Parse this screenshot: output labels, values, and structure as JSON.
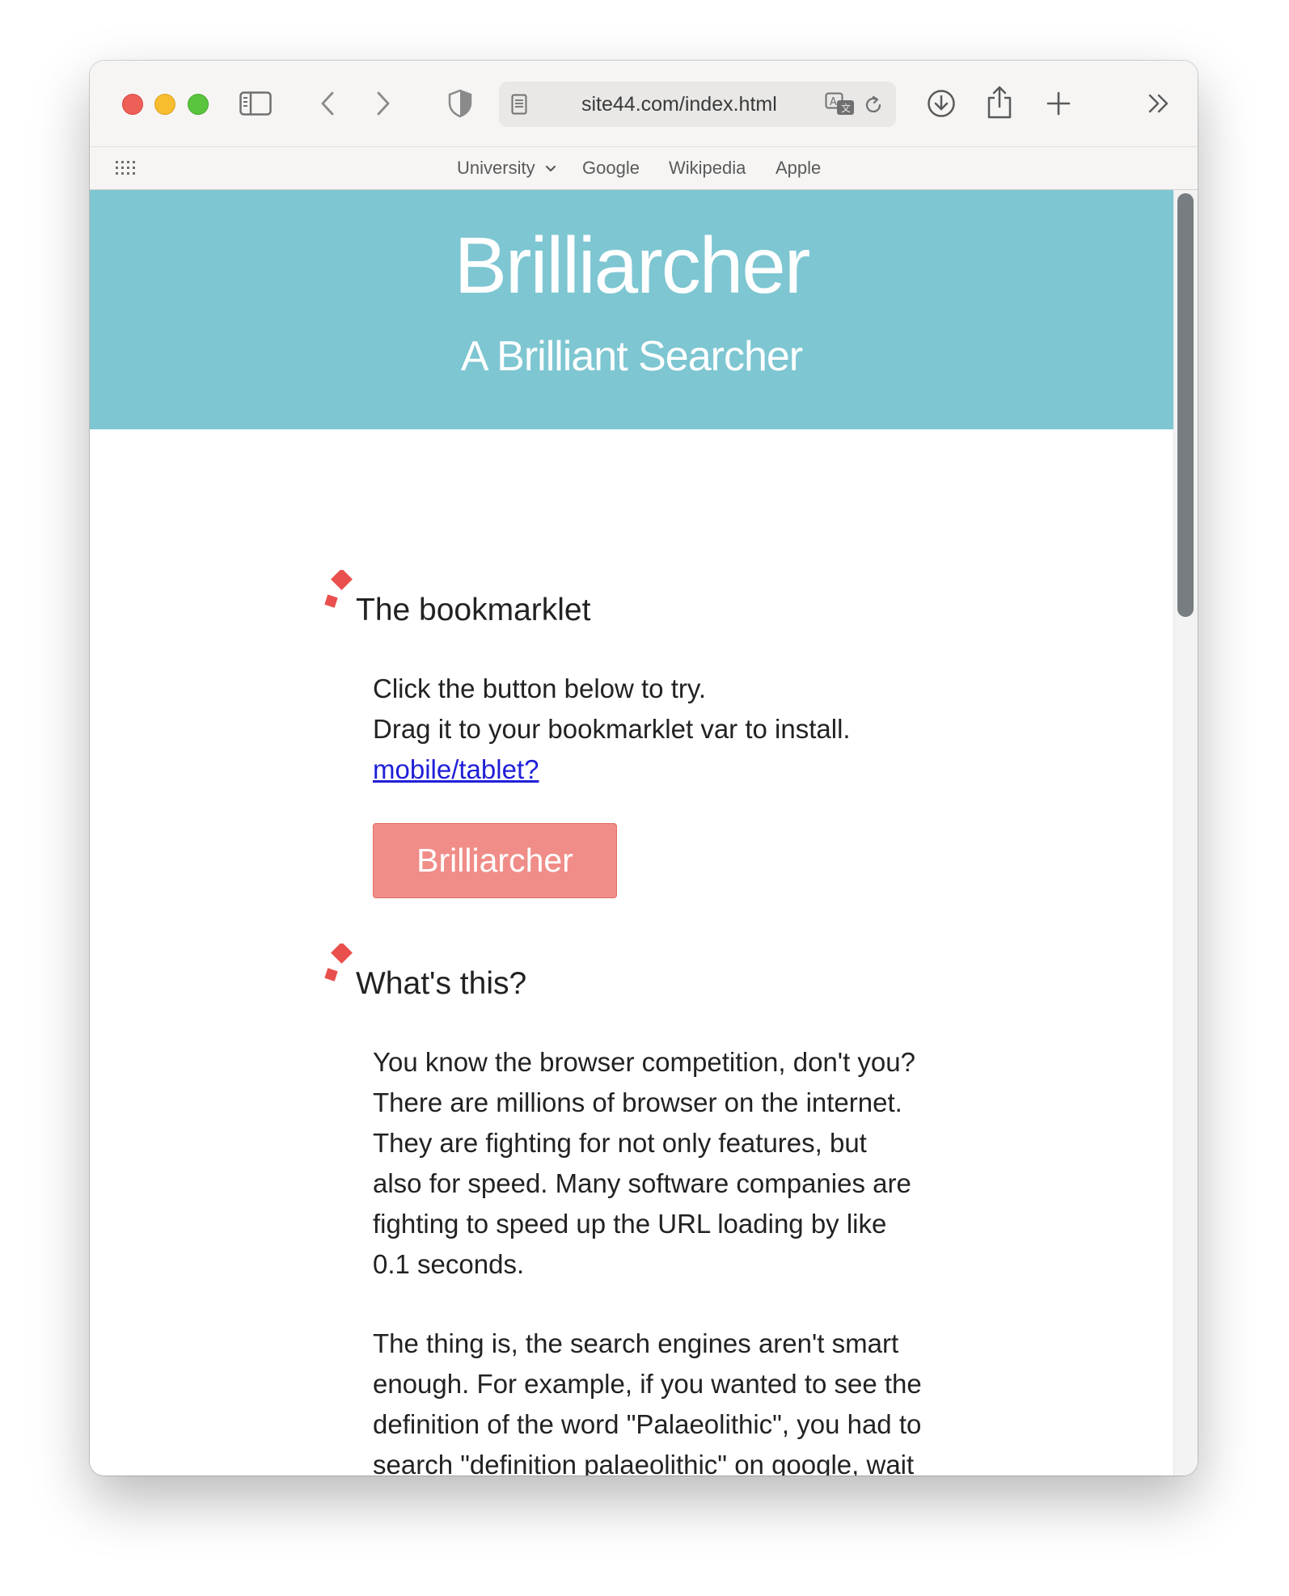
{
  "browser": {
    "address": "site44.com/index.html",
    "favorites": [
      {
        "label": "University"
      },
      {
        "label": "Google"
      },
      {
        "label": "Wikipedia"
      },
      {
        "label": "Apple"
      }
    ],
    "icons": {
      "sidebar": "sidebar-icon",
      "back": "chevron-left-icon",
      "forward": "chevron-right-icon",
      "privacy": "shield-icon",
      "page": "page-icon",
      "translate": "translate-icon",
      "reload": "reload-icon",
      "download": "download-icon",
      "share": "share-icon",
      "new_tab": "plus-icon",
      "more": "double-chevron-right-icon",
      "grid": "grid-icon"
    }
  },
  "page": {
    "hero": {
      "title": "Brilliarcher",
      "subtitle": "A Brilliant Searcher",
      "background": "#7dc6d2"
    },
    "bookmarklet": {
      "heading": "The bookmarklet",
      "line1": "Click the button below to try.",
      "line2": "Drag it to your bookmarklet var to install.",
      "link": "mobile/tablet?",
      "button_label": "Brilliarcher",
      "button_color": "#f08d88"
    },
    "whats_this": {
      "heading": "What's this?",
      "paragraph1": "You know the browser competition, don't you? There are millions of browser on the internet. They are fighting for not only features, but also for speed. Many software companies are fighting to speed up the URL loading by like 0.1 seconds.",
      "paragraph2": "The thing is, the search engines aren't smart enough. For example, if you wanted to see the definition of the word \"Palaeolithic\", you had to search \"definition palaeolithic\" on google, wait for the result to come up, and"
    },
    "accent_color": "#e9504d"
  }
}
